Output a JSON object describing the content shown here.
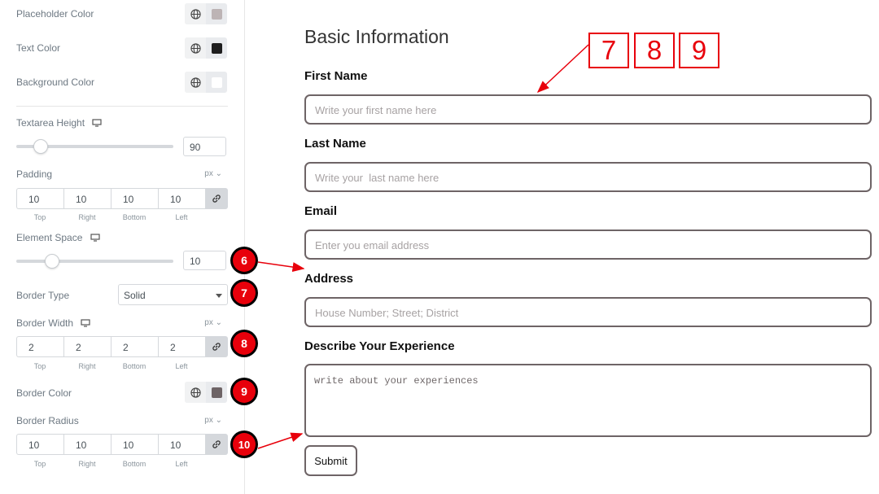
{
  "panel": {
    "placeholder_color": {
      "label": "Placeholder Color",
      "swatch": "#bdb4b5"
    },
    "text_color": {
      "label": "Text Color",
      "swatch": "#1e1e1e"
    },
    "background_color": {
      "label": "Background Color",
      "swatch": "#ffffff"
    },
    "textarea_height": {
      "label": "Textarea Height",
      "value": "90",
      "slider_fraction": 0.12
    },
    "padding": {
      "label": "Padding",
      "unit": "px",
      "values": [
        "10",
        "10",
        "10",
        "10"
      ],
      "captions": [
        "Top",
        "Right",
        "Bottom",
        "Left"
      ]
    },
    "element_space": {
      "label": "Element Space",
      "value": "10",
      "slider_fraction": 0.2
    },
    "border_type": {
      "label": "Border Type",
      "value": "Solid"
    },
    "border_width": {
      "label": "Border Width",
      "unit": "px",
      "values": [
        "2",
        "2",
        "2",
        "2"
      ],
      "captions": [
        "Top",
        "Right",
        "Bottom",
        "Left"
      ]
    },
    "border_color": {
      "label": "Border Color",
      "swatch": "#6e6466"
    },
    "border_radius": {
      "label": "Border Radius",
      "unit": "px",
      "values": [
        "10",
        "10",
        "10",
        "10"
      ],
      "captions": [
        "Top",
        "Right",
        "Bottom",
        "Left"
      ]
    }
  },
  "badges": [
    "6",
    "7",
    "8",
    "9",
    "10"
  ],
  "callout_boxes": [
    "7",
    "8",
    "9"
  ],
  "form": {
    "title": "Basic Information",
    "first_name": {
      "label": "First Name",
      "placeholder": "Write your first name here"
    },
    "last_name": {
      "label": "Last Name",
      "placeholder": "Write your  last name here"
    },
    "email": {
      "label": "Email",
      "placeholder": "Enter you email address"
    },
    "address": {
      "label": "Address",
      "placeholder": "House Number; Street; District"
    },
    "experience": {
      "label": "Describe Your Experience",
      "placeholder": "write about your experiences"
    },
    "submit_label": "Submit"
  },
  "colors": {
    "annotation": "#e8000b",
    "field_border": "#6e6466"
  },
  "icons": [
    "globe-icon",
    "monitor-icon",
    "link-icon",
    "chevron-down-icon"
  ]
}
